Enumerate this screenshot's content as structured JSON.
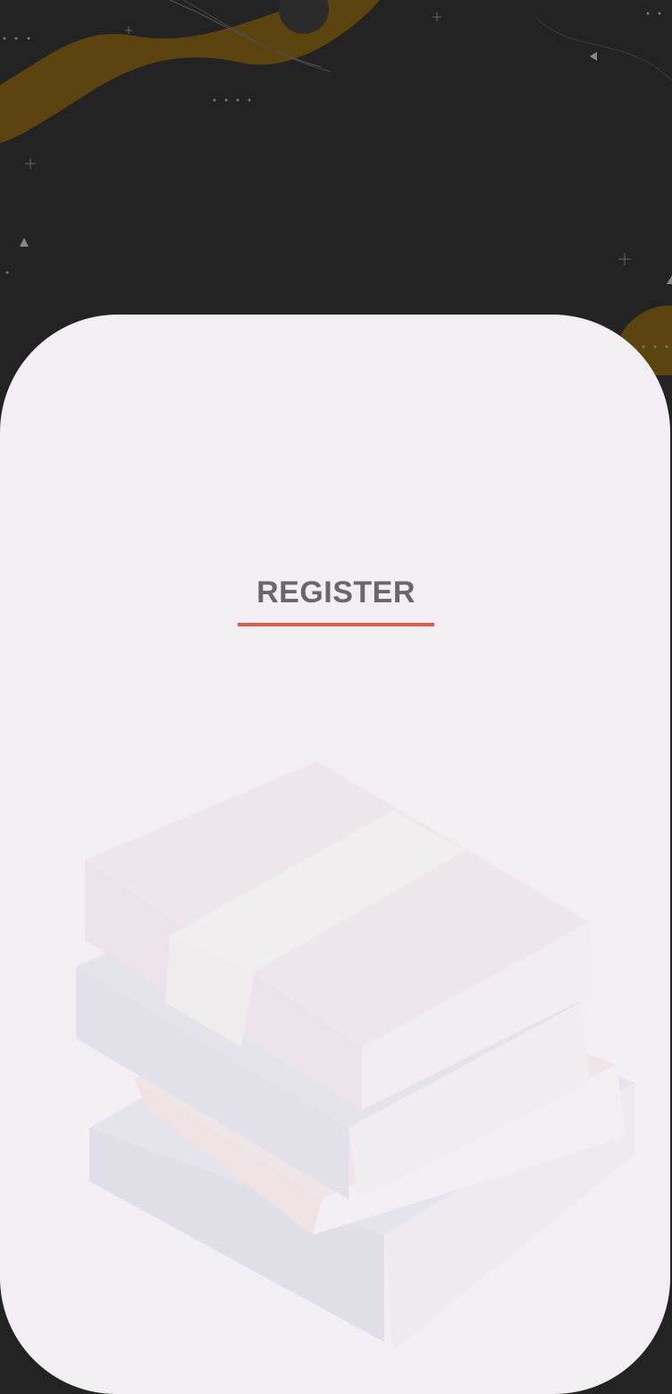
{
  "register": {
    "title": "REGISTER"
  },
  "theme": {
    "background": "#232323",
    "card": "#f2eef4",
    "title_color": "#6b6668",
    "accent": "#e15a4c",
    "decor_gold": "#7a5a10"
  },
  "decor": {
    "background_pattern": "gold-wave-pattern",
    "illustration": "books-stack-illustration"
  }
}
